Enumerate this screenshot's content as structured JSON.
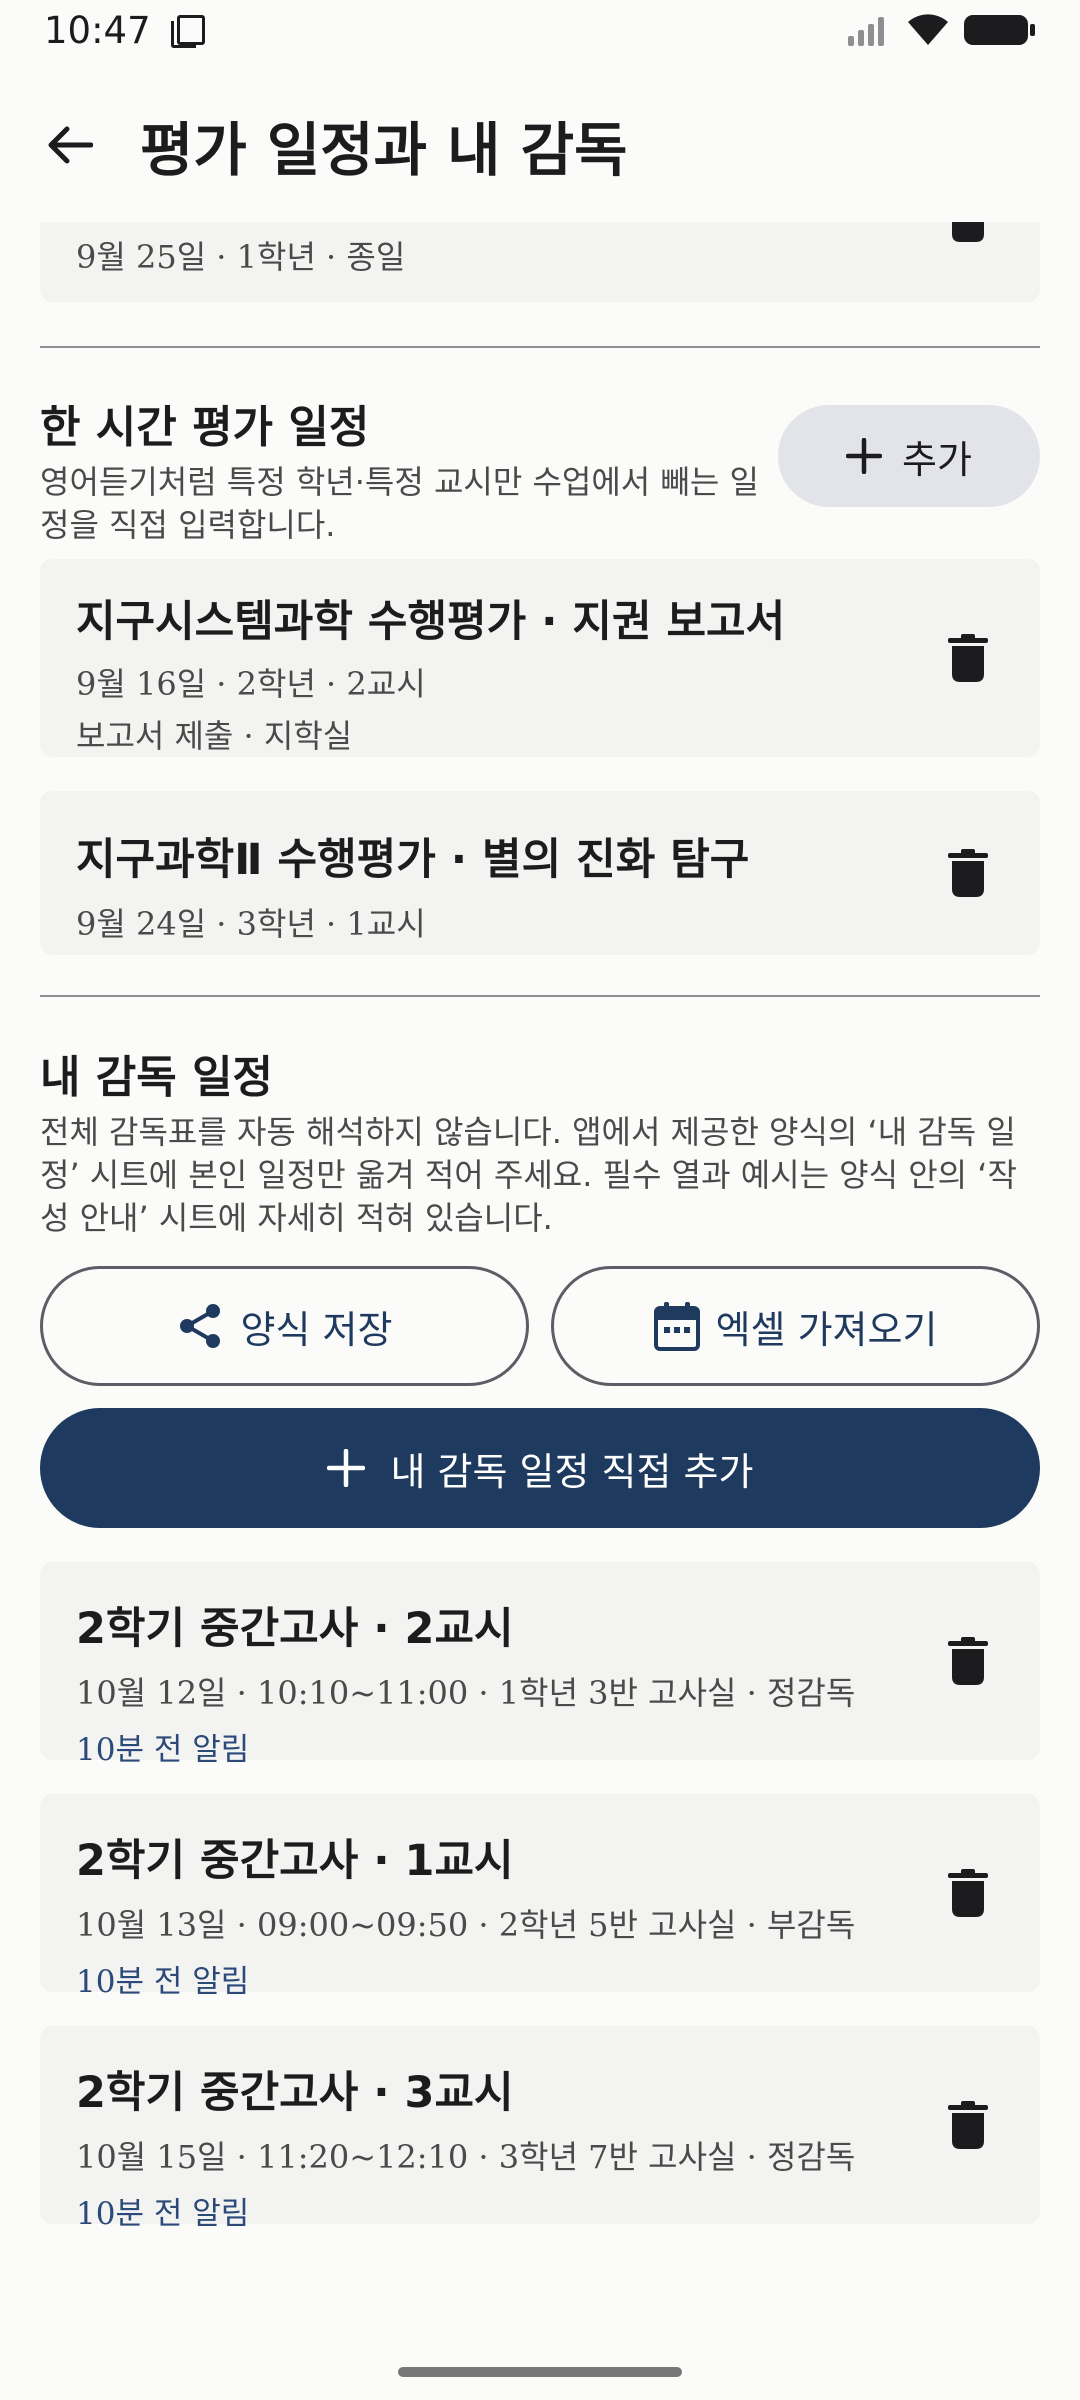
{
  "status_bar": {
    "time": "10:47"
  },
  "app_bar": {
    "title": "평가 일정과 내 감독"
  },
  "top_partial_card": {
    "subtitle": "9월 25일 · 1학년 · 종일"
  },
  "hourly_section": {
    "title": "한 시간 평가 일정",
    "description": "영어듣기처럼 특정 학년·특정 교시만 수업에서 빼는 일정을 직접 입력합니다.",
    "add_label": "추가",
    "items": [
      {
        "title": "지구시스템과학 수행평가 · 지권 보고서",
        "subtitle": "9월 16일 · 2학년 · 2교시",
        "note": "보고서 제출 · 지학실"
      },
      {
        "title": "지구과학Ⅱ 수행평가 · 별의 진화 탐구",
        "subtitle": "9월 24일 · 3학년 · 1교시"
      }
    ]
  },
  "proctor_section": {
    "title": "내 감독 일정",
    "description": "전체 감독표를 자동 해석하지 않습니다. 앱에서 제공한 양식의 ‘내 감독 일정’ 시트에 본인 일정만 옮겨 적어 주세요. 필수 열과 예시는 양식 안의 ‘작성 안내’ 시트에 자세히 적혀 있습니다.",
    "save_template_label": "양식 저장",
    "import_excel_label": "엑셀 가져오기",
    "add_direct_label": "내 감독 일정 직접 추가",
    "items": [
      {
        "title": "2학기 중간고사 · 2교시",
        "subtitle": "10월 12일 · 10:10~11:00 · 1학년 3반 고사실 · 정감독",
        "reminder": "10분 전 알림"
      },
      {
        "title": "2학기 중간고사 · 1교시",
        "subtitle": "10월 13일 · 09:00~09:50 · 2학년 5반 고사실 · 부감독",
        "reminder": "10분 전 알림"
      },
      {
        "title": "2학기 중간고사 · 3교시",
        "subtitle": "10월 15일 · 11:20~12:10 · 3학년 7반 고사실 · 정감독",
        "reminder": "10분 전 알림"
      }
    ]
  },
  "colors": {
    "primary": "#1f3a5f",
    "card": "#f3f3f1",
    "background": "#fbfbf9",
    "pill": "#e3e4ea"
  }
}
